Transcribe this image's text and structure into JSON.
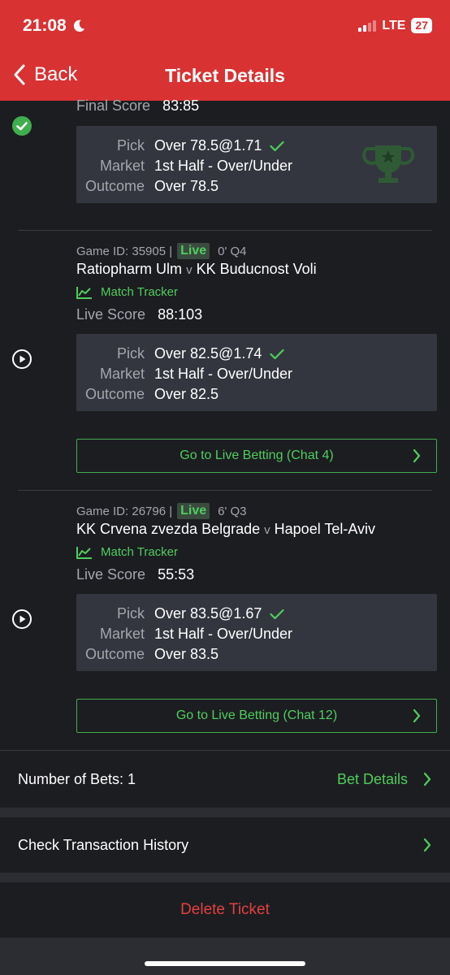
{
  "status_bar": {
    "time": "21:08",
    "network": "LTE",
    "battery": "27"
  },
  "nav": {
    "back_label": "Back",
    "title": "Ticket Details"
  },
  "bet1": {
    "score_label": "Final Score",
    "score": "83:85",
    "pick_label": "Pick",
    "pick": "Over 78.5@1.71",
    "market_label": "Market",
    "market": "1st Half - Over/Under",
    "outcome_label": "Outcome",
    "outcome": "Over 78.5"
  },
  "bet2": {
    "game_id": "Game ID: 35905 |",
    "live": "Live",
    "clock": "0' Q4",
    "home": "Ratiopharm Ulm",
    "vs": "v",
    "away": "KK Buducnost Voli",
    "tracker": "Match Tracker",
    "score_label": "Live Score",
    "score": "88:103",
    "pick_label": "Pick",
    "pick": "Over 82.5@1.74",
    "market_label": "Market",
    "market": "1st Half - Over/Under",
    "outcome_label": "Outcome",
    "outcome": "Over 82.5",
    "go_live": "Go to Live Betting (Chat 4)"
  },
  "bet3": {
    "game_id": "Game ID: 26796 |",
    "live": "Live",
    "clock": "6' Q3",
    "home": "KK Crvena zvezda Belgrade",
    "vs": "v",
    "away": "Hapoel Tel-Aviv",
    "tracker": "Match Tracker",
    "score_label": "Live Score",
    "score": "55:53",
    "pick_label": "Pick",
    "pick": "Over 83.5@1.67",
    "market_label": "Market",
    "market": "1st Half - Over/Under",
    "outcome_label": "Outcome",
    "outcome": "Over 83.5",
    "go_live": "Go to Live Betting (Chat 12)"
  },
  "footer": {
    "num_bets": "Number of Bets: 1",
    "bet_details": "Bet Details",
    "history": "Check Transaction History",
    "delete": "Delete Ticket"
  },
  "colors": {
    "header": "#d83233",
    "accent_green": "#4fce5d",
    "danger": "#e2403e",
    "background": "#1c1d21",
    "card": "#33363e"
  }
}
